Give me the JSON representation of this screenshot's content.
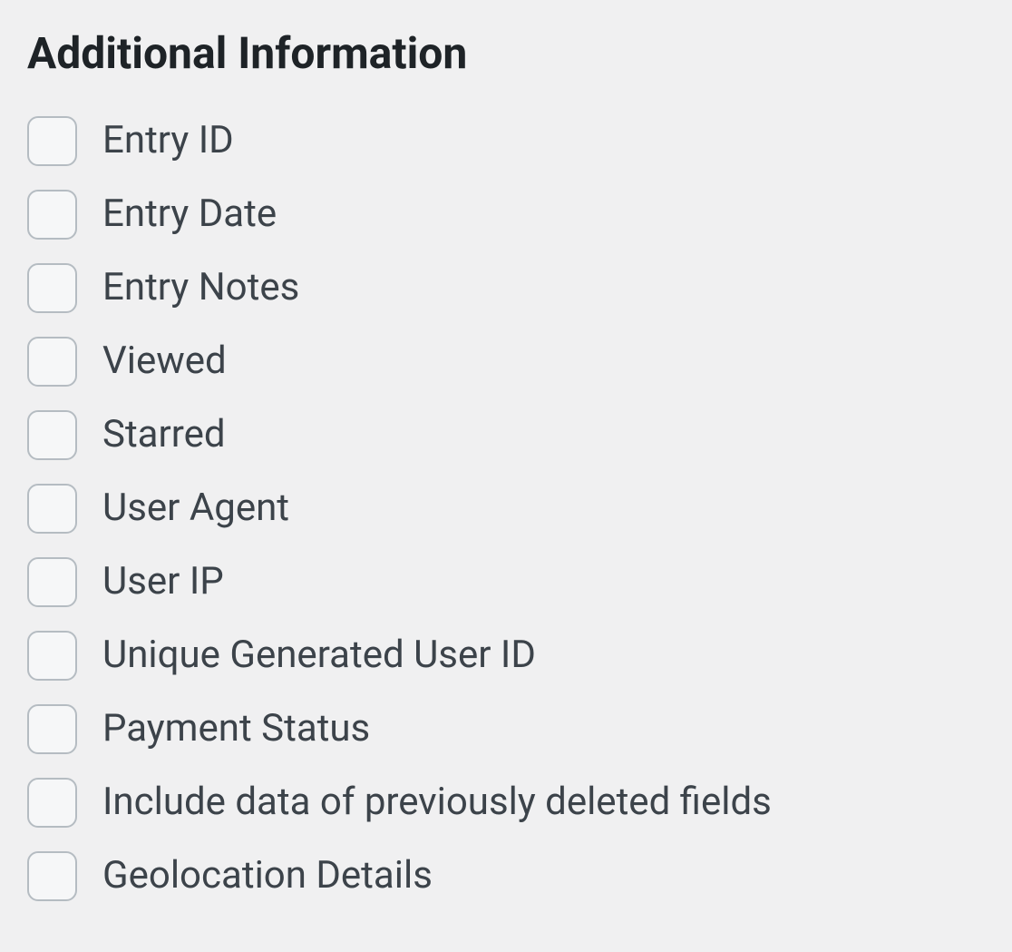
{
  "section": {
    "title": "Additional Information",
    "options": [
      {
        "id": "entry-id",
        "label": "Entry ID"
      },
      {
        "id": "entry-date",
        "label": "Entry Date"
      },
      {
        "id": "entry-notes",
        "label": "Entry Notes"
      },
      {
        "id": "viewed",
        "label": "Viewed"
      },
      {
        "id": "starred",
        "label": "Starred"
      },
      {
        "id": "user-agent",
        "label": "User Agent"
      },
      {
        "id": "user-ip",
        "label": "User IP"
      },
      {
        "id": "unique-generated-user-id",
        "label": "Unique Generated User ID"
      },
      {
        "id": "payment-status",
        "label": "Payment Status"
      },
      {
        "id": "include-deleted-fields",
        "label": "Include data of previously deleted fields"
      },
      {
        "id": "geolocation-details",
        "label": "Geolocation Details"
      }
    ]
  }
}
